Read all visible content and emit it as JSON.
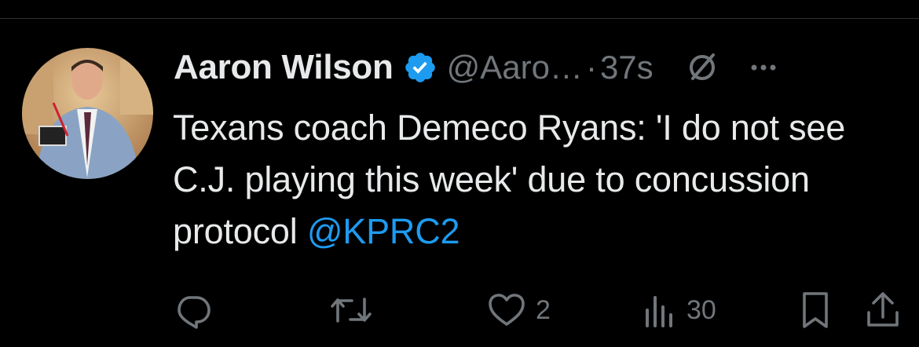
{
  "tweet": {
    "author_name": "Aaron Wilson",
    "handle": "@Aaro…",
    "separator": "·",
    "time": "37s",
    "text": "Texans coach Demeco Ryans: 'I do not see C.J. playing this week' due to concussion protocol",
    "mention": "@KPRC2"
  },
  "actions": {
    "reply_count": "",
    "retweet_count": "",
    "like_count": "2",
    "views_count": "30"
  },
  "colors": {
    "background": "#000000",
    "text": "#e7e9ea",
    "muted": "#71767b",
    "accent": "#1d9bf0"
  },
  "icons": [
    "verified-badge-icon",
    "grok-icon",
    "more-icon",
    "reply-icon",
    "retweet-icon",
    "like-icon",
    "views-icon",
    "bookmark-icon",
    "share-icon"
  ]
}
